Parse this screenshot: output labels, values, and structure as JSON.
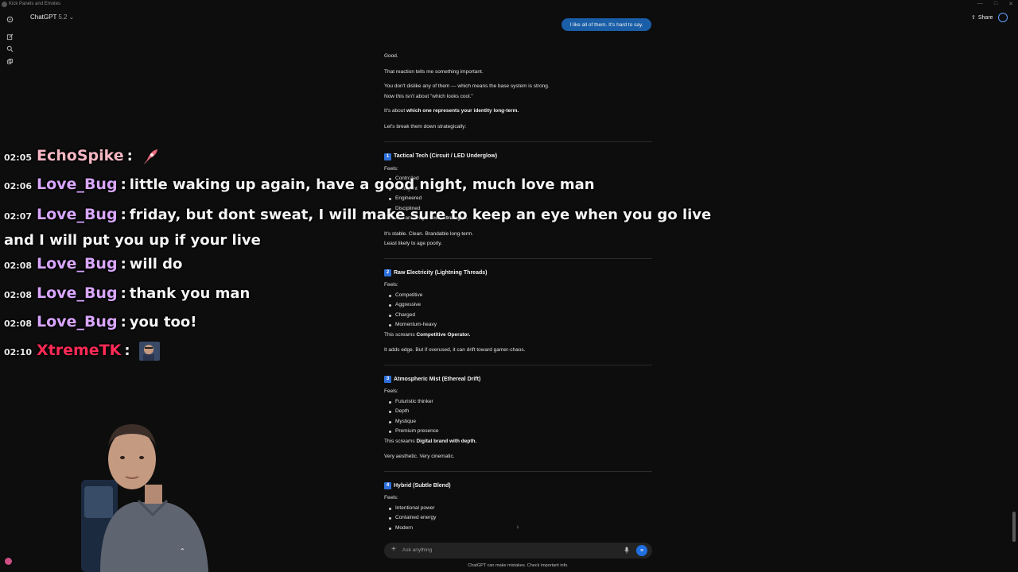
{
  "window": {
    "title": "Kick Panels and Emotes"
  },
  "header": {
    "model_name": "ChatGPT",
    "model_version": "5.2",
    "share_label": "Share"
  },
  "user_message": "I like all of them. It's hard to say.",
  "response": {
    "intro": [
      "Good.",
      "That reaction tells me something important.",
      "You don't dislike any of them — which means the base system is strong.",
      "Now this isn't about \"which looks cool.\"",
      "It's about",
      "which one represents your identity long-term.",
      "Let's break them down strategically:"
    ],
    "feels_label": "Feels:",
    "this_screams": "This screams",
    "sections": [
      {
        "num": "1",
        "title": "Tactical Tech (Circuit / LED Underglow)",
        "bullets": [
          "Controlled",
          "Intelligent",
          "Engineered",
          "Disciplined"
        ],
        "screams": "High-Tech Strategist.",
        "notes": [
          "It's stable. Clean. Brandable long-term.",
          "Least likely to age poorly."
        ]
      },
      {
        "num": "2",
        "title": "Raw Electricity (Lightning Threads)",
        "bullets": [
          "Competitive",
          "Aggressive",
          "Charged",
          "Momentum-heavy"
        ],
        "screams": "Competitive Operator.",
        "notes": [
          "It adds edge. But if overused, it can drift toward gamer-chaos."
        ]
      },
      {
        "num": "3",
        "title": "Atmospheric Mist (Ethereal Drift)",
        "bullets": [
          "Futuristic thinker",
          "Depth",
          "Mystique",
          "Premium presence"
        ],
        "screams": "Digital brand with depth.",
        "notes": [
          "Very aesthetic. Very cinematic."
        ]
      },
      {
        "num": "4",
        "title": "Hybrid (Subtle Blend)",
        "bullets": [
          "Intentional power",
          "Contained energy",
          "Modern"
        ]
      }
    ]
  },
  "composer": {
    "placeholder": "Ask anything"
  },
  "disclaimer": "ChatGPT can make mistakes. Check important info.",
  "stream_chat": [
    {
      "time": "02:05",
      "user": "EchoSpike",
      "color": "#f4b6c2",
      "text": "",
      "emote": "rocket"
    },
    {
      "time": "02:06",
      "user": "Love_Bug",
      "color": "#d9a6ff",
      "text": "little waking up again, have a good night, much love man"
    },
    {
      "time": "02:07",
      "user": "Love_Bug",
      "color": "#d9a6ff",
      "text": "friday, but dont sweat, I will make sure to keep an eye when you go live and I will put you up if your live"
    },
    {
      "time": "02:08",
      "user": "Love_Bug",
      "color": "#d9a6ff",
      "text": "will do"
    },
    {
      "time": "02:08",
      "user": "Love_Bug",
      "color": "#d9a6ff",
      "text": "thank you man"
    },
    {
      "time": "02:08",
      "user": "Love_Bug",
      "color": "#d9a6ff",
      "text": "you too!"
    },
    {
      "time": "02:10",
      "user": "XtremeTK",
      "color": "#ff2a55",
      "text": "",
      "emote": "face"
    }
  ],
  "colors": {
    "accent": "#1f6fe0",
    "user_bubble": "#1a5ea8",
    "background": "#0d0d0d"
  }
}
